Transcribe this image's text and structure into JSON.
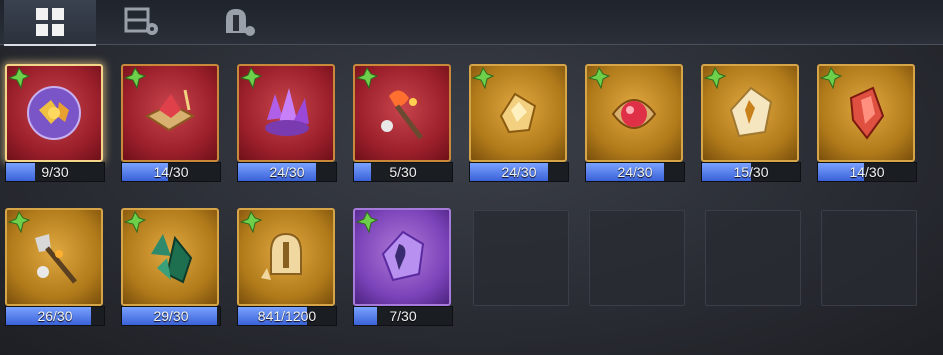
{
  "tabs": [
    {
      "icon": "grid-icon",
      "active": true
    },
    {
      "icon": "puzzle-gear-icon",
      "active": false
    },
    {
      "icon": "helmet-puzzle-icon",
      "active": false
    }
  ],
  "items": [
    {
      "name": "orb-fragment",
      "theme": "red",
      "selected": true,
      "count": "9/30",
      "progress": 0.3
    },
    {
      "name": "tome-fragment",
      "theme": "red",
      "selected": false,
      "count": "14/30",
      "progress": 0.47
    },
    {
      "name": "amethyst-cluster",
      "theme": "red",
      "selected": false,
      "count": "24/30",
      "progress": 0.8
    },
    {
      "name": "flame-scepter",
      "theme": "red",
      "selected": false,
      "count": "5/30",
      "progress": 0.17
    },
    {
      "name": "golden-shard",
      "theme": "gold",
      "selected": false,
      "count": "24/30",
      "progress": 0.8
    },
    {
      "name": "ruby-orb",
      "theme": "gold",
      "selected": false,
      "count": "24/30",
      "progress": 0.8
    },
    {
      "name": "rune-crystal",
      "theme": "gold",
      "selected": false,
      "count": "15/30",
      "progress": 0.5
    },
    {
      "name": "red-crystal",
      "theme": "gold",
      "selected": false,
      "count": "14/30",
      "progress": 0.47
    },
    {
      "name": "gold-scepter",
      "theme": "gold",
      "selected": false,
      "count": "26/30",
      "progress": 0.87
    },
    {
      "name": "emerald-cluster",
      "theme": "gold",
      "selected": false,
      "count": "29/30",
      "progress": 0.97
    },
    {
      "name": "helmet-token",
      "theme": "gold",
      "selected": false,
      "count": "841/1200",
      "progress": 0.7
    },
    {
      "name": "spirit-crystal",
      "theme": "purple",
      "selected": false,
      "count": "7/30",
      "progress": 0.23
    }
  ],
  "colors": {
    "progress": "#4a7ae8",
    "frame_gold": "#d6a548",
    "selected_glow": "#f3d68a"
  }
}
